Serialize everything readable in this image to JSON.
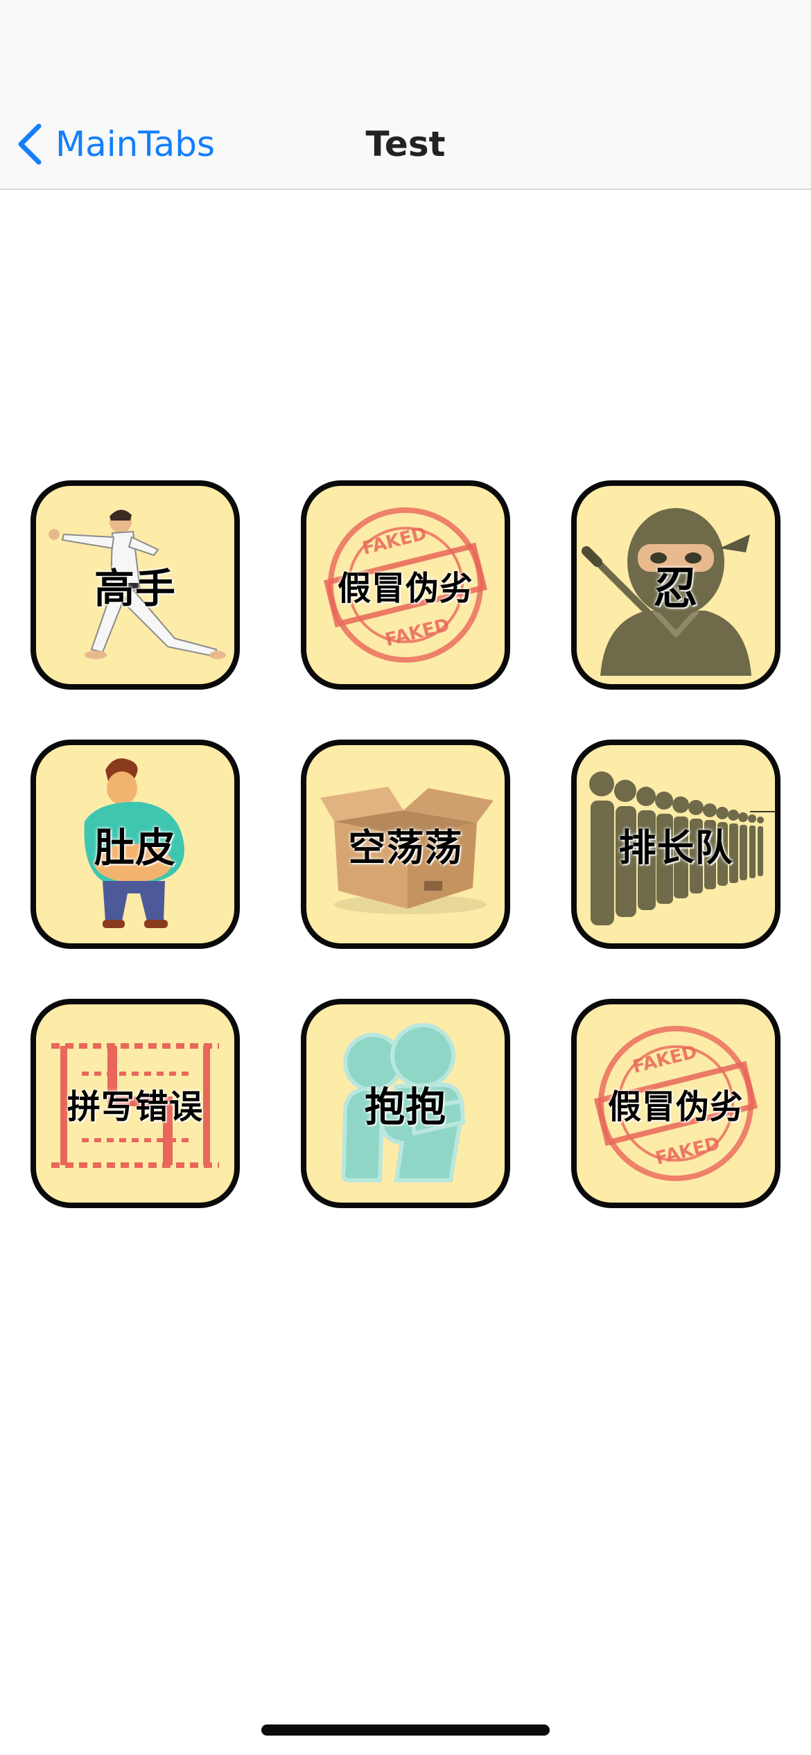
{
  "nav": {
    "back_label": "MainTabs",
    "title": "Test",
    "accent_color": "#147efb"
  },
  "tiles": [
    {
      "label": "高手",
      "icon": "kung-fu-master-icon"
    },
    {
      "label": "假冒伪劣",
      "icon": "faked-stamp-icon",
      "stamp_text": "FAKED"
    },
    {
      "label": "忍",
      "icon": "ninja-icon"
    },
    {
      "label": "肚皮",
      "icon": "big-belly-man-icon"
    },
    {
      "label": "空荡荡",
      "icon": "empty-cardboard-box-icon"
    },
    {
      "label": "排长队",
      "icon": "long-queue-icon"
    },
    {
      "label": "拼写错误",
      "icon": "typo-letter-icon"
    },
    {
      "label": "抱抱",
      "icon": "hug-icon"
    },
    {
      "label": "假冒伪劣",
      "icon": "faked-stamp-icon",
      "stamp_text": "FAKED"
    }
  ],
  "colors": {
    "tile_background": "#fdeba8",
    "tile_border": "#0a0a0a",
    "stamp_red": "#e8675a",
    "figure_olive": "#6e6a4a",
    "hug_teal": "#8fd6c6"
  }
}
